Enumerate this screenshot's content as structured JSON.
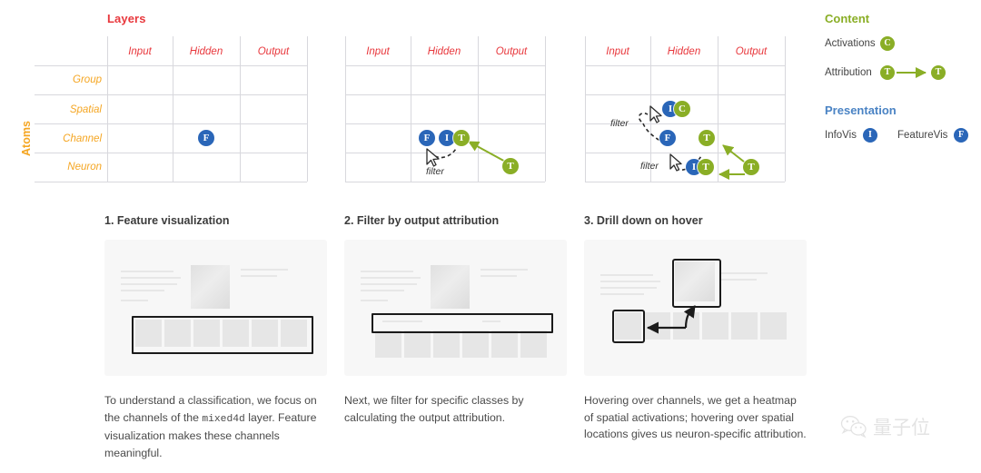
{
  "diagram": {
    "axis_title_layers": "Layers",
    "axis_title_atoms": "Atoms",
    "columns": [
      "Input",
      "Hidden",
      "Output"
    ],
    "rows": [
      "Group",
      "Spatial",
      "Channel",
      "Neuron"
    ],
    "filter_label": "filter",
    "panels": [
      {
        "id": "panel-1",
        "show_row_labels": true,
        "show_title": true,
        "badges": [
          {
            "letter": "F",
            "kind": "blue",
            "col": "Hidden",
            "row": "Channel"
          }
        ]
      },
      {
        "id": "panel-2",
        "show_row_labels": false,
        "show_title": false,
        "badges": [
          {
            "letter": "F",
            "kind": "blue",
            "col": "Hidden",
            "row": "Channel"
          },
          {
            "letter": "I",
            "kind": "blue",
            "col": "Hidden",
            "row": "Channel"
          },
          {
            "letter": "T",
            "kind": "green",
            "col": "Hidden",
            "row": "Channel"
          },
          {
            "letter": "T",
            "kind": "green",
            "col": "Output",
            "row": "Neuron"
          }
        ],
        "filters": [
          "filter"
        ]
      },
      {
        "id": "panel-3",
        "show_row_labels": false,
        "show_title": false,
        "badges": [
          {
            "letter": "I",
            "kind": "blue",
            "col": "Hidden",
            "row": "Spatial"
          },
          {
            "letter": "C",
            "kind": "green",
            "col": "Hidden",
            "row": "Spatial"
          },
          {
            "letter": "F",
            "kind": "blue",
            "col": "Hidden",
            "row": "Channel"
          },
          {
            "letter": "T",
            "kind": "green",
            "col": "Output",
            "row": "Channel"
          },
          {
            "letter": "I",
            "kind": "blue",
            "col": "Output",
            "row": "Neuron"
          },
          {
            "letter": "T",
            "kind": "green",
            "col": "Output",
            "row": "Neuron"
          },
          {
            "letter": "T",
            "kind": "green",
            "col": "Output",
            "row": "Neuron"
          }
        ],
        "filters": [
          "filter",
          "filter"
        ]
      }
    ]
  },
  "legend": {
    "content": {
      "heading": "Content",
      "items": [
        {
          "label": "Activations",
          "badges": [
            {
              "letter": "C",
              "kind": "green"
            }
          ],
          "arrow": false
        },
        {
          "label": "Attribution",
          "badges": [
            {
              "letter": "T",
              "kind": "green"
            },
            {
              "letter": "T",
              "kind": "green"
            }
          ],
          "arrow": true
        }
      ]
    },
    "presentation": {
      "heading": "Presentation",
      "items": [
        {
          "label": "InfoVis",
          "badges": [
            {
              "letter": "I",
              "kind": "blue"
            }
          ]
        },
        {
          "label": "FeatureVis",
          "badges": [
            {
              "letter": "F",
              "kind": "blue"
            }
          ]
        }
      ]
    }
  },
  "steps": [
    {
      "title": "1. Feature visualization",
      "body_1": "To understand a classification, we focus on the channels of the ",
      "body_code": "mixed4d",
      "body_2": " layer. Feature visualization makes these channels meaningful."
    },
    {
      "title": "2. Filter by output attribution",
      "body_1": "Next, we filter for specific classes by calculating the output attribution.",
      "body_code": "",
      "body_2": ""
    },
    {
      "title": "3. Drill down on hover",
      "body_1": "Hovering over channels, we get a heatmap of spatial activations; hovering over spatial locations gives us neuron-specific attribution.",
      "body_code": "",
      "body_2": ""
    }
  ],
  "watermark": {
    "text": "量子位"
  },
  "colors": {
    "layers_red": "#e8383d",
    "atoms_orange": "#f5a623",
    "badge_blue": "#2a66b8",
    "badge_green": "#8aae26",
    "presentation_blue": "#4a83c4",
    "grid_line": "#d8d8dd"
  }
}
